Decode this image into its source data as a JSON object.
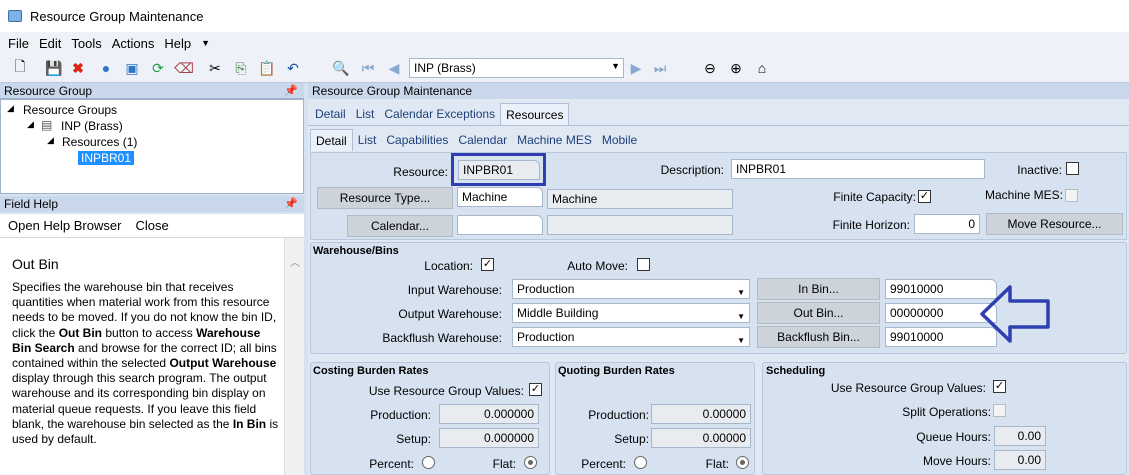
{
  "window": {
    "title": "Resource Group Maintenance"
  },
  "menu": [
    "File",
    "Edit",
    "Tools",
    "Actions",
    "Help"
  ],
  "toolbar": {
    "nav_combo": "INP (Brass)"
  },
  "left_panel": {
    "title": "Resource Group",
    "tree": {
      "root": "Resource Groups",
      "group": "INP (Brass)",
      "resources": "Resources (1)",
      "selected": "INPBR01"
    }
  },
  "field_help": {
    "title": "Field Help",
    "open_browser": "Open Help Browser",
    "close": "Close",
    "heading": "Out Bin",
    "body_parts": {
      "t1": "Specifies the warehouse bin that receives quantities when material work from this resource needs to be moved. If you do not know the bin ID, click the ",
      "b1": "Out Bin",
      "t2": " button to access ",
      "b2": "Warehouse Bin Search",
      "t3": " and browse for the correct ID; all bins contained within the selected ",
      "b3": "Output Warehouse",
      "t4": " display through this search program. The output warehouse and its corresponding bin display on material queue requests. If you leave this field blank, the warehouse bin selected as the ",
      "b4": "In Bin",
      "t5": " is used by default."
    }
  },
  "main": {
    "title": "Resource Group Maintenance",
    "tabs_top": [
      "Detail",
      "List",
      "Calendar Exceptions",
      "Resources"
    ],
    "tabs_sub": [
      "Detail",
      "List",
      "Capabilities",
      "Calendar",
      "Machine MES",
      "Mobile"
    ],
    "resource_label": "Resource:",
    "resource_value": "INPBR01",
    "description_label": "Description:",
    "description_value": "INPBR01",
    "inactive_label": "Inactive:",
    "resource_type_btn": "Resource Type...",
    "resource_type_code": "Machine",
    "resource_type_desc": "Machine",
    "finite_capacity_label": "Finite Capacity:",
    "machine_mes_label": "Machine MES:",
    "calendar_btn": "Calendar...",
    "finite_horizon_label": "Finite Horizon:",
    "finite_horizon_value": "0",
    "move_resource_btn": "Move Resource...",
    "warehouse": {
      "title": "Warehouse/Bins",
      "location_label": "Location:",
      "auto_move_label": "Auto Move:",
      "input_wh_label": "Input Warehouse:",
      "input_wh_value": "Production",
      "output_wh_label": "Output Warehouse:",
      "output_wh_value": "Middle Building",
      "backflush_wh_label": "Backflush Warehouse:",
      "backflush_wh_value": "Production",
      "in_bin_btn": "In Bin...",
      "in_bin_value": "99010000",
      "out_bin_btn": "Out Bin...",
      "out_bin_value": "00000000",
      "backflush_bin_btn": "Backflush Bin...",
      "backflush_bin_value": "99010000"
    },
    "costing": {
      "title": "Costing Burden Rates",
      "use_group_label": "Use Resource Group Values:",
      "production_label": "Production:",
      "production_value": "0.000000",
      "setup_label": "Setup:",
      "setup_value": "0.000000",
      "percent_label": "Percent:",
      "flat_label": "Flat:"
    },
    "quoting": {
      "title": "Quoting Burden Rates",
      "production_label": "Production:",
      "production_value": "0.00000",
      "setup_label": "Setup:",
      "setup_value": "0.00000",
      "percent_label": "Percent:",
      "flat_label": "Flat:"
    },
    "scheduling": {
      "title": "Scheduling",
      "use_group_label": "Use Resource Group Values:",
      "split_label": "Split Operations:",
      "queue_label": "Queue Hours:",
      "queue_value": "0.00",
      "move_label": "Move Hours:",
      "move_value": "0.00"
    }
  },
  "colors": {
    "highlight_box": "#2f3fb0",
    "selection": "#1e90ff"
  }
}
